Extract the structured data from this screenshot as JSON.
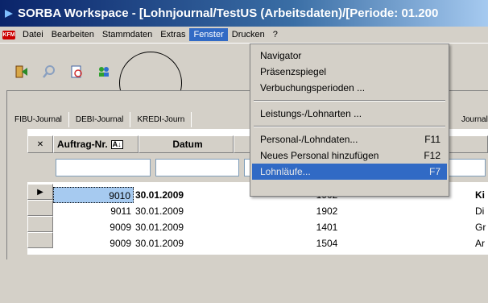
{
  "window": {
    "title": "SORBA Workspace - [Lohnjournal/TestUS (Arbeitsdaten)/[Periode: 01.200"
  },
  "menubar": {
    "app_badge": "KFM",
    "items": [
      "Datei",
      "Bearbeiten",
      "Stammdaten",
      "Extras",
      "Fenster",
      "Drucken",
      "?"
    ],
    "active_index": 4
  },
  "toolbar": {
    "icons": [
      "exit-icon",
      "search-icon",
      "document-icon",
      "users-icon"
    ]
  },
  "tabs": [
    "FIBU-Journal",
    "DEBI-Journal",
    "KREDI-Journ",
    "Journal"
  ],
  "grid": {
    "columns": [
      "Auftrag-Nr.",
      "Datum"
    ],
    "rows": [
      {
        "auftrag": "9010",
        "datum": "30.01.2009",
        "code": "1902",
        "last": "Ki"
      },
      {
        "auftrag": "9011",
        "datum": "30.01.2009",
        "code": "1902",
        "last": "Di"
      },
      {
        "auftrag": "9009",
        "datum": "30.01.2009",
        "code": "1401",
        "last": "Gr"
      },
      {
        "auftrag": "9009",
        "datum": "30.01.2009",
        "code": "1504",
        "last": "Ar"
      }
    ],
    "selected_row": 0
  },
  "fenster_menu": {
    "items": [
      {
        "label": "Navigator",
        "shortcut": ""
      },
      {
        "label": "Präsenzspiegel",
        "shortcut": ""
      },
      {
        "label": "Verbuchungsperioden ...",
        "shortcut": ""
      },
      {
        "label": "Leistungs-/Lohnarten ...",
        "shortcut": ""
      },
      {
        "label": "Personal-/Lohndaten...",
        "shortcut": "F11"
      },
      {
        "label": "Neues Personal hinzufügen",
        "shortcut": "F12"
      },
      {
        "label": "Lohnläufe...",
        "shortcut": "F7"
      }
    ],
    "highlighted_index": 6
  }
}
